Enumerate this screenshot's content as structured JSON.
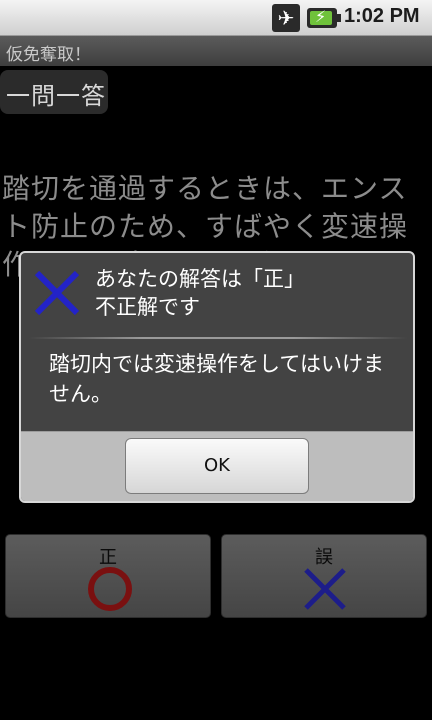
{
  "status_bar": {
    "time": "1:02 PM",
    "icons": [
      "airplane-mode-icon",
      "battery-charging-icon"
    ]
  },
  "app": {
    "title": "仮免奪取！"
  },
  "category": {
    "label": "一問一答"
  },
  "question": {
    "text": "踏切を通過するときは、エンスト防止のため、すばやく変速操作をし、速やかに通過する。"
  },
  "answers": {
    "true_label": "正",
    "false_label": "誤",
    "true_color": "#7a1010",
    "false_color": "#1d1d8a"
  },
  "dialog": {
    "title_line1": "あなたの解答は「正」",
    "title_line2": "不正解です",
    "message": "踏切内では変速操作をしてはいけません。",
    "ok_label": "OK",
    "icon": "wrong-cross-icon",
    "icon_color": "#2323c8"
  }
}
